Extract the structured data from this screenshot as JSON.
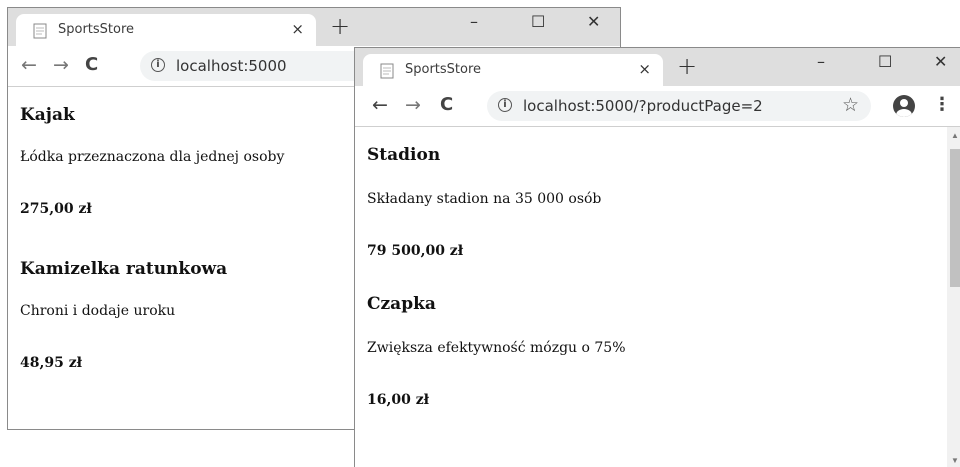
{
  "windows": [
    {
      "tab_title": "SportsStore",
      "url": "localhost:5000",
      "products": [
        {
          "name": "Kajak",
          "description": "Łódka przeznaczona dla jednej osoby",
          "price": "275,00 zł"
        },
        {
          "name": "Kamizelka ratunkowa",
          "description": "Chroni i dodaje uroku",
          "price": "48,95 zł"
        }
      ]
    },
    {
      "tab_title": "SportsStore",
      "url": "localhost:5000/?productPage=2",
      "products": [
        {
          "name": "Stadion",
          "description": "Składany stadion na 35 000 osób",
          "price": "79 500,00 zł"
        },
        {
          "name": "Czapka",
          "description": "Zwiększa efektywność mózgu o 75%",
          "price": "16,00 zł"
        }
      ]
    }
  ],
  "icons": {
    "close": "×",
    "new_tab": "+",
    "minimize": "–",
    "maximize": "☐",
    "window_close": "✕",
    "back": "←",
    "forward": "→",
    "reload": "C",
    "info": "i",
    "star": "☆",
    "menu": "⋮"
  }
}
